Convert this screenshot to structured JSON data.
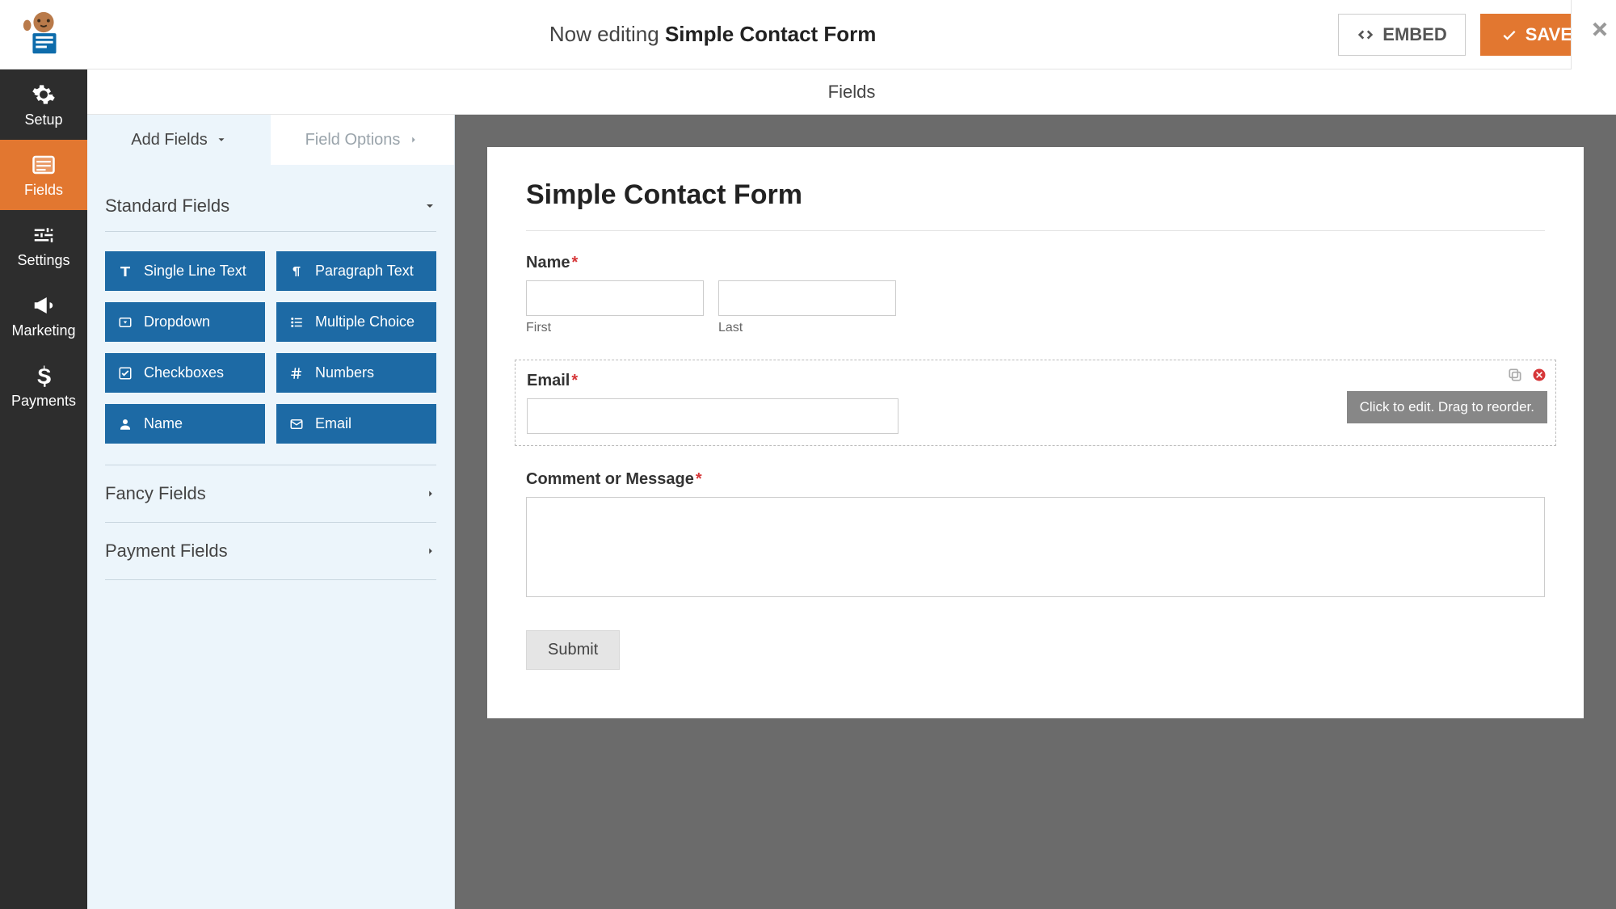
{
  "header": {
    "editing_prefix": "Now editing",
    "form_name": "Simple Contact Form",
    "embed_label": "EMBED",
    "save_label": "SAVE"
  },
  "section_title": "Fields",
  "leftnav": [
    {
      "label": "Setup"
    },
    {
      "label": "Fields"
    },
    {
      "label": "Settings"
    },
    {
      "label": "Marketing"
    },
    {
      "label": "Payments"
    }
  ],
  "tabs": {
    "add_fields": "Add Fields",
    "field_options": "Field Options"
  },
  "accordion": {
    "standard": "Standard Fields",
    "fancy": "Fancy Fields",
    "payment": "Payment Fields"
  },
  "standard_fields": [
    "Single Line Text",
    "Paragraph Text",
    "Dropdown",
    "Multiple Choice",
    "Checkboxes",
    "Numbers",
    "Name",
    "Email"
  ],
  "preview": {
    "title": "Simple Contact Form",
    "name_label": "Name",
    "first_sub": "First",
    "last_sub": "Last",
    "email_label": "Email",
    "tooltip": "Click to edit. Drag to reorder.",
    "message_label": "Comment or Message",
    "submit_label": "Submit"
  }
}
